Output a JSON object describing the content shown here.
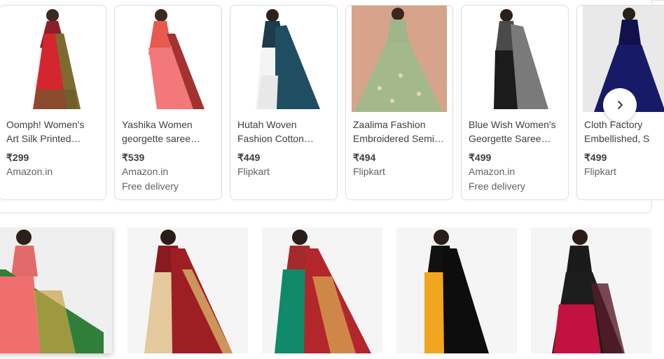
{
  "products": [
    {
      "title_line1": "Oomph! Women's",
      "title_line2": "Art Silk Printed…",
      "price": "₹299",
      "store": "Amazon.in",
      "delivery": ""
    },
    {
      "title_line1": "Yashika Women",
      "title_line2": "georgette saree…",
      "price": "₹539",
      "store": "Amazon.in",
      "delivery": "Free delivery"
    },
    {
      "title_line1": "Hutah Woven",
      "title_line2": "Fashion Cotton…",
      "price": "₹449",
      "store": "Flipkart",
      "delivery": ""
    },
    {
      "title_line1": "Zaalima Fashion",
      "title_line2": "Embroidered Semi…",
      "price": "₹494",
      "store": "Flipkart",
      "delivery": ""
    },
    {
      "title_line1": "Blue Wish Women's",
      "title_line2": "Georgette Saree…",
      "price": "₹499",
      "store": "Amazon.in",
      "delivery": "Free delivery"
    },
    {
      "title_line1": "Cloth Factory",
      "title_line2": "Embellished, S",
      "price": "₹499",
      "store": "Flipkart",
      "delivery": ""
    }
  ],
  "next_button": {
    "icon": "chevron-right-icon"
  },
  "colors": {
    "border": "#dadce0",
    "price": "#3c4043",
    "muted": "#5f6368"
  }
}
